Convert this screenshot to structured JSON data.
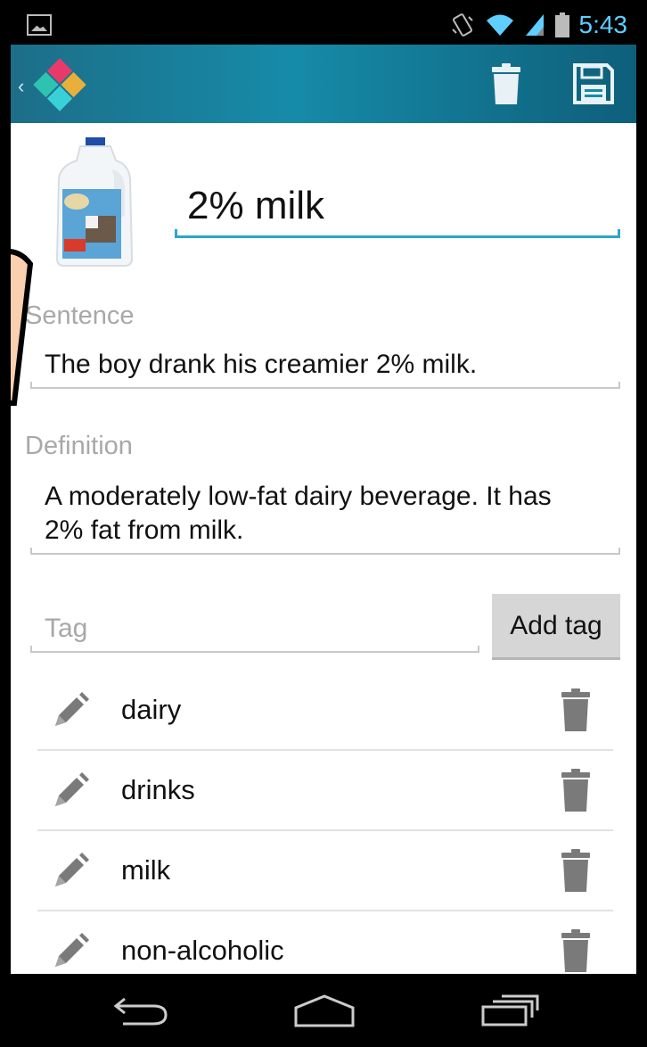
{
  "status_bar": {
    "time": "5:43"
  },
  "action_bar": {
    "logo_icon": "app-logo-icon",
    "delete_icon": "trash-icon",
    "save_icon": "floppy-disk-icon"
  },
  "card": {
    "name": "2% milk",
    "sentence_label": "Sentence",
    "sentence_value": "The boy drank his creamier 2% milk.",
    "definition_label": "Definition",
    "definition_line1": "A moderately low-fat dairy beverage. It has",
    "definition_line2": "2% fat from milk."
  },
  "tags": {
    "input_placeholder": "Tag",
    "add_label": "Add tag",
    "items": [
      {
        "label": "dairy"
      },
      {
        "label": "drinks"
      },
      {
        "label": "milk"
      },
      {
        "label": "non-alcoholic"
      }
    ]
  },
  "colors": {
    "accent": "#2ba5cc",
    "action_bar": "#168ba8",
    "status_icons": "#5ecfff"
  }
}
